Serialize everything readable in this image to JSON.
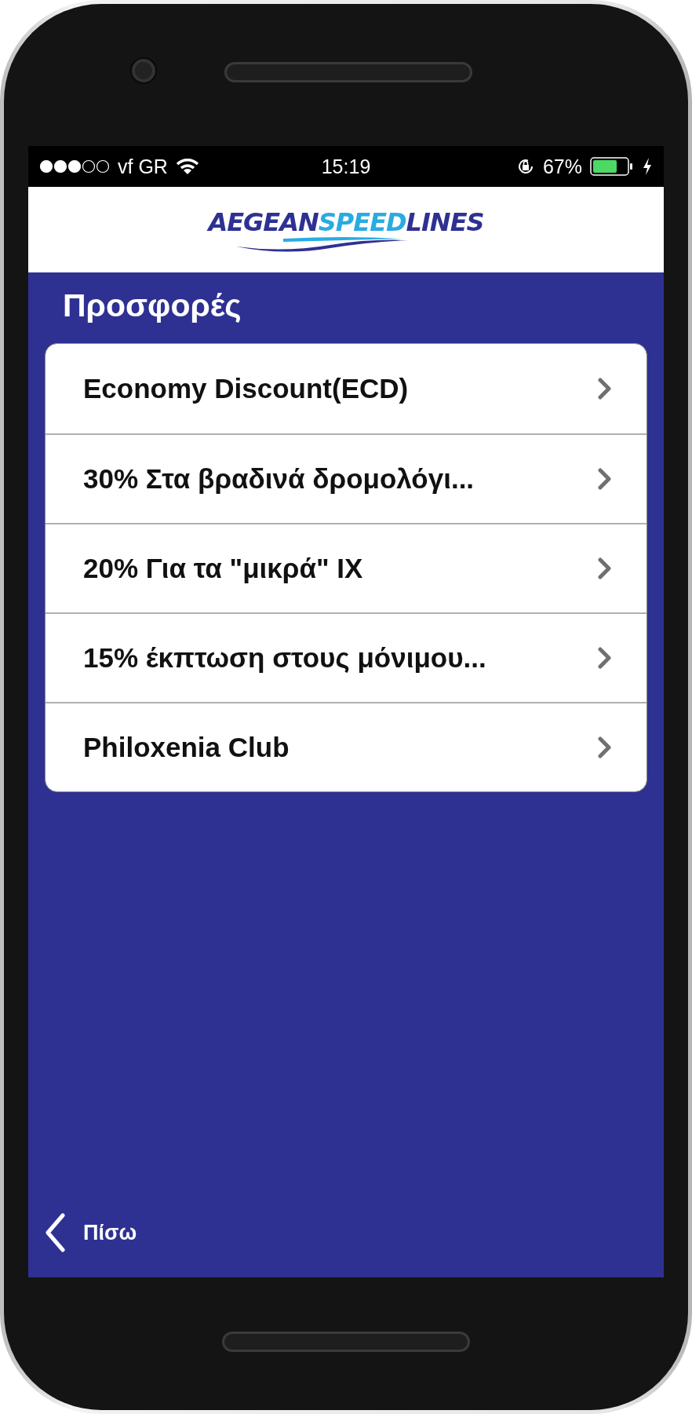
{
  "status_bar": {
    "carrier": "vf GR",
    "time": "15:19",
    "battery_text": "67%"
  },
  "header": {
    "logo": [
      "AEGEAN",
      "SPEED",
      "LINES"
    ]
  },
  "page": {
    "title": "Προσφορές"
  },
  "offers": [
    {
      "label": "Economy Discount(ECD)"
    },
    {
      "label": "30% Στα βραδινά δρομολόγι..."
    },
    {
      "label": "20% Για τα \"μικρά\" ΙΧ"
    },
    {
      "label": "15% έκπτωση στους μόνιμου..."
    },
    {
      "label": "Philoxenia Club"
    }
  ],
  "footer": {
    "back": "Πίσω"
  }
}
